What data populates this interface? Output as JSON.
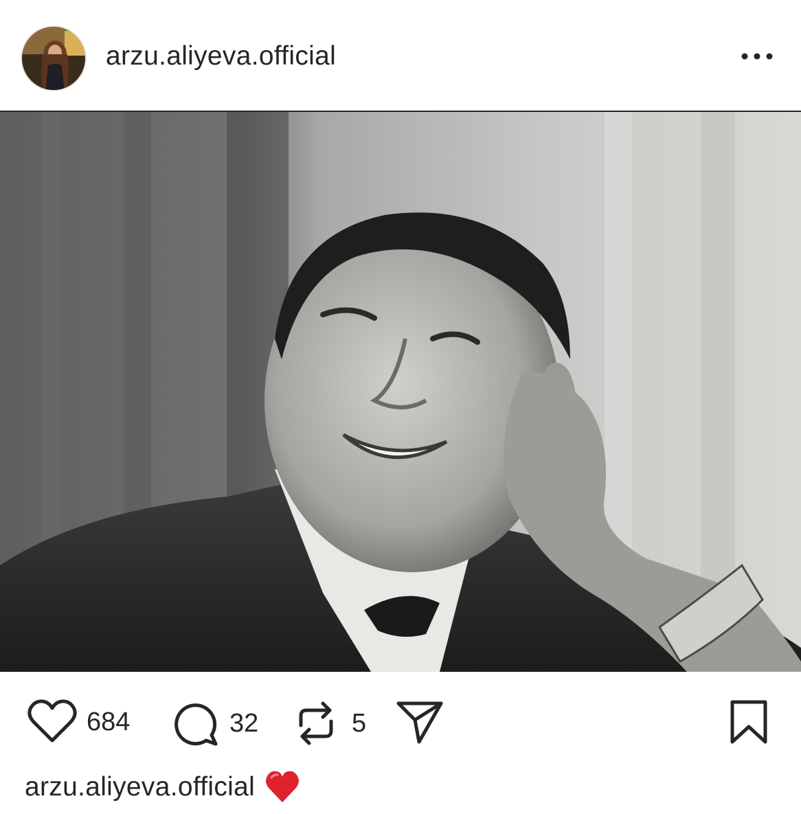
{
  "post": {
    "username": "arzu.aliyeva.official",
    "likes": "684",
    "comments": "32",
    "reposts": "5",
    "caption_user": "arzu.aliyeva.official"
  },
  "icons": {
    "more": "more-horizontal-icon",
    "like": "heart-outline-icon",
    "comment": "comment-bubble-icon",
    "repost": "repost-arrows-icon",
    "share": "paper-plane-icon",
    "save": "bookmark-icon",
    "caption_emoji": "red-heart-emoji"
  },
  "colors": {
    "text": "#262626",
    "heart_emoji": "#e0212e"
  }
}
